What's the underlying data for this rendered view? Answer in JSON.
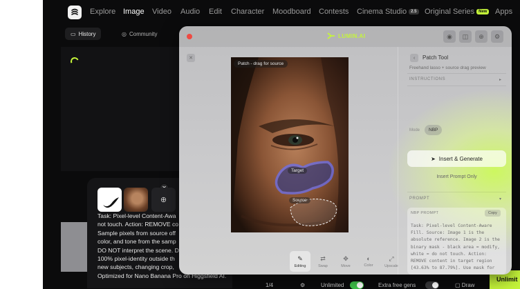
{
  "nav": {
    "items": [
      {
        "label": "Explore",
        "active": false
      },
      {
        "label": "Image",
        "active": true
      },
      {
        "label": "Video",
        "active": false
      },
      {
        "label": "Audio",
        "active": false
      },
      {
        "label": "Edit",
        "active": false
      },
      {
        "label": "Character",
        "active": false
      },
      {
        "label": "Moodboard",
        "active": false
      },
      {
        "label": "Contests",
        "active": false
      },
      {
        "label": "Cinema Studio",
        "active": false,
        "badge": "2.5"
      },
      {
        "label": "Original Series",
        "active": false,
        "badge": "New"
      },
      {
        "label": "Apps",
        "active": false
      }
    ]
  },
  "left": {
    "tabs": [
      "History",
      "Community"
    ],
    "prompt_lines": [
      "Task: Pixel-level Content-Awa",
      "not touch. Action: REMOVE co",
      "Sample pixels from source off",
      "color, and tone from the samp",
      "DO NOT interpret the scene. D",
      "100% pixel-identity outside th",
      "new subjects, changing crop,",
      "Optimized for Nano Banana Pro on Higgsfield AI."
    ]
  },
  "bottom": {
    "page": "1/4",
    "unlimited": "Unlimited",
    "extra_free_gens": "Extra free gens",
    "draw": "Draw",
    "cta": "Unlimit"
  },
  "modal": {
    "brand": "LUMIN.AI",
    "photo_label": "Patch - drag for source",
    "target_label": "Target",
    "source_label": "Source",
    "tools": [
      {
        "label": "Editing",
        "icon": "pencil-icon",
        "active": true
      },
      {
        "label": "Swap",
        "icon": "swap-icon",
        "active": false
      },
      {
        "label": "Move",
        "icon": "move-icon",
        "active": false
      },
      {
        "label": "Color",
        "icon": "color-icon",
        "active": false
      },
      {
        "label": "Upscale",
        "icon": "upscale-icon",
        "active": false
      }
    ],
    "side": {
      "title": "Patch Tool",
      "subtitle": "Freehand lasso + source drag preview",
      "instructions": "INSTRUCTIONS",
      "mode_label": "Mode",
      "mode_value": "NBP",
      "insert_generate": "Insert & Generate",
      "insert_only": "Insert Prompt Only",
      "prompt_section": "PROMPT",
      "nbp_prompt_label": "NBP PROMPT",
      "copy": "Copy",
      "prompt_text_lines": [
        "Task: Pixel-level Content-Aware",
        "Fill. Source: Image 1 is the",
        "absolute reference. Image 2 is the",
        "binary mask - black area = modify,",
        "white = do not touch. Action:",
        "REMOVE content in target region",
        "[43.63% to 87.79%]. Use mask for",
        "..."
      ]
    }
  },
  "colors": {
    "accent": "#c5f53a",
    "close_dot": "#ef4a42",
    "lasso_target": "#5b5fe6"
  }
}
